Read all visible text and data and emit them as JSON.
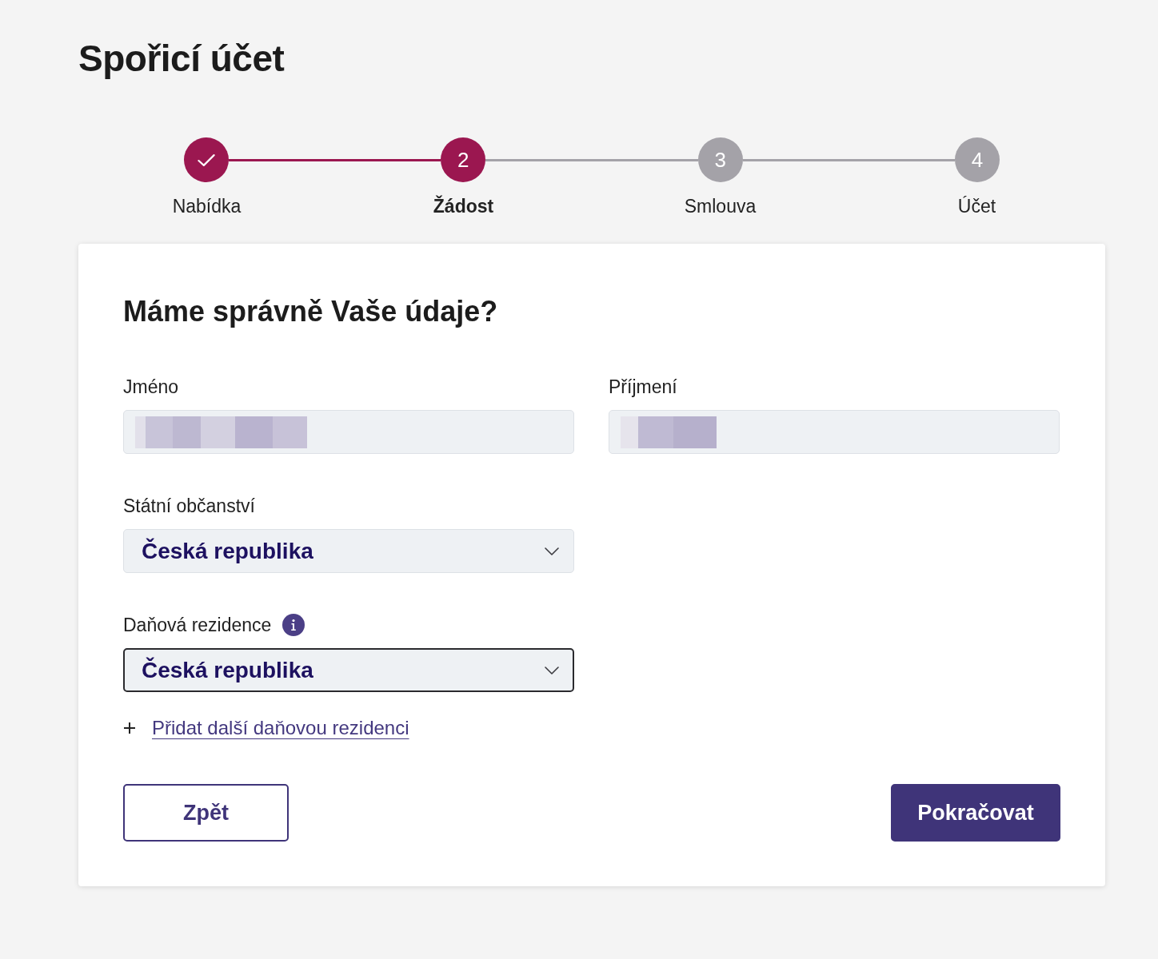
{
  "page": {
    "title": "Spořicí účet"
  },
  "steps": [
    {
      "label": "Nabídka",
      "done": true,
      "selected": false
    },
    {
      "number": "2",
      "label": "Žádost",
      "done": false,
      "selected": true
    },
    {
      "number": "3",
      "label": "Smlouva",
      "done": false,
      "selected": false
    },
    {
      "number": "4",
      "label": "Účet",
      "done": false,
      "selected": false
    }
  ],
  "form": {
    "heading": "Máme správně Vaše údaje?",
    "rows": [
      [
        {
          "kind": "text",
          "label": "Jméno",
          "redacted": true
        },
        {
          "kind": "text",
          "label": "Příjmení",
          "redacted": true
        }
      ],
      [
        {
          "kind": "select",
          "label": "Státní občanství",
          "value": "Česká republika",
          "focused": false
        }
      ],
      [
        {
          "kind": "select",
          "label": "Daňová rezidence",
          "info": true,
          "value": "Česká republika",
          "focused": true
        }
      ]
    ],
    "add_link": "Přidat další daňovou rezidenci",
    "buttons": [
      {
        "kind": "secondary",
        "label": "Zpět"
      },
      {
        "kind": "primary",
        "label": "Pokračovat"
      }
    ]
  }
}
